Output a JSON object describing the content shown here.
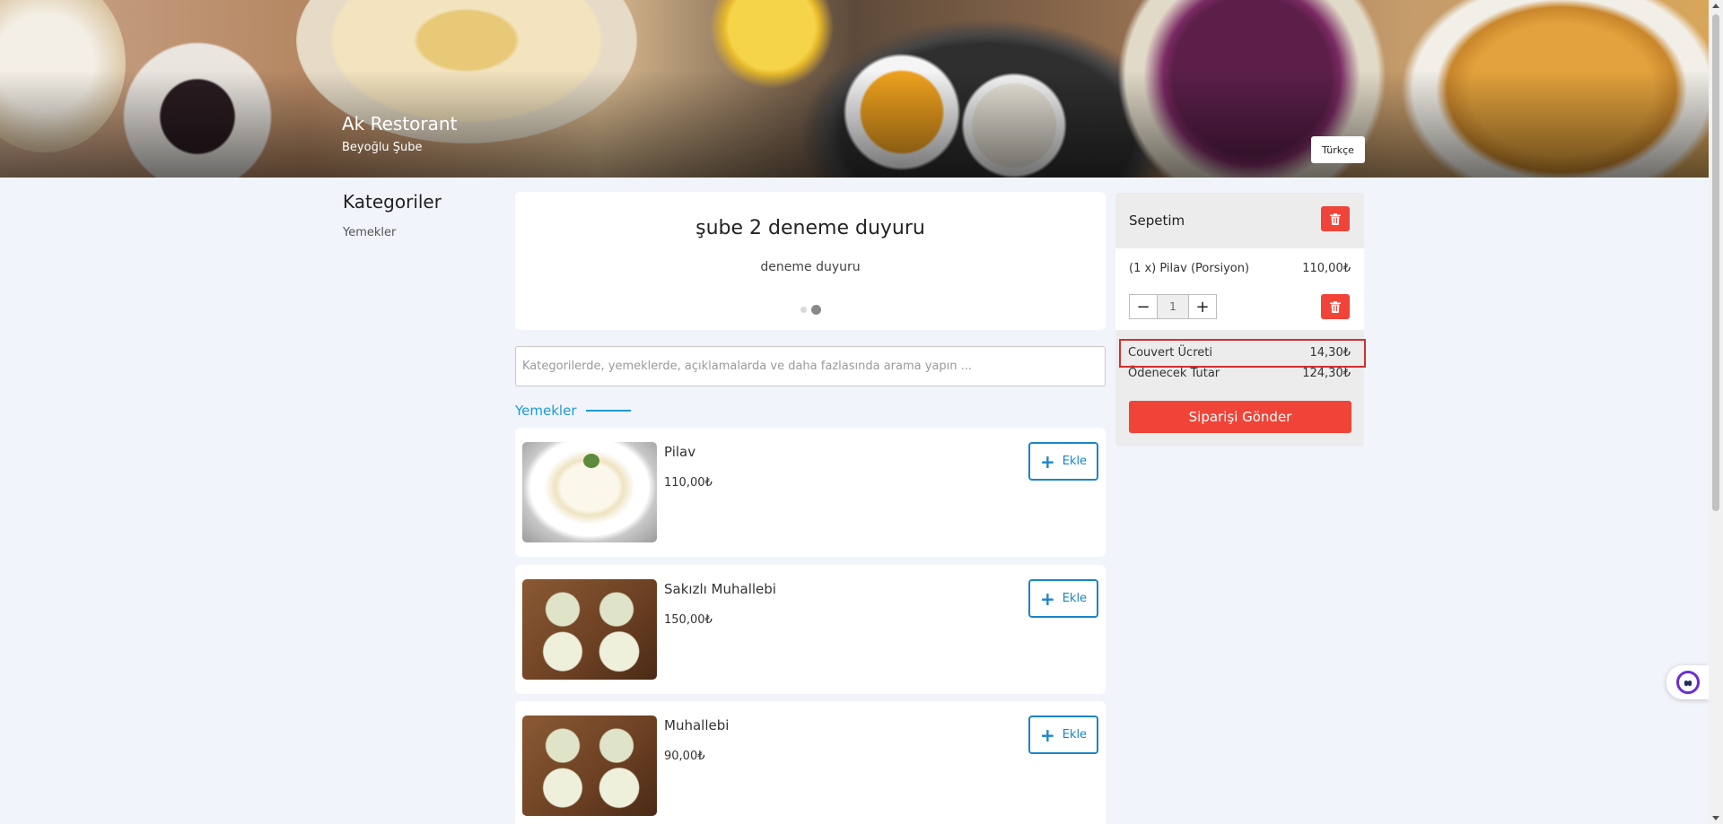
{
  "restaurant": {
    "name": "Ak Restorant",
    "branch": "Beyoğlu Şube"
  },
  "language_button": "Türkçe",
  "categories": {
    "title": "Kategoriler",
    "items": [
      "Yemekler"
    ]
  },
  "announcement": {
    "title": "şube 2 deneme duyuru",
    "body": "deneme duyuru",
    "slide_count": 2,
    "active_slide": 2
  },
  "search": {
    "placeholder": "Kategorilerde, yemeklerde, açıklamalarda ve daha fazlasında arama yapın ..."
  },
  "section": {
    "title": "Yemekler"
  },
  "products": [
    {
      "name": "Pilav",
      "price": "110,00₺",
      "button": "Ekle",
      "image": "rice-pilaf"
    },
    {
      "name": "Sakızlı Muhallebi",
      "price": "150,00₺",
      "button": "Ekle",
      "image": "pudding-cups"
    },
    {
      "name": "Muhallebi",
      "price": "90,00₺",
      "button": "Ekle",
      "image": "pudding-cups"
    }
  ],
  "cart": {
    "title": "Sepetim",
    "line": {
      "label": "(1 x) Pilav (Porsiyon)",
      "price": "110,00₺",
      "quantity": "1",
      "minus": "−",
      "plus": "+"
    },
    "cover_fee_label": "Couvert Ücreti",
    "cover_fee_value": "14,30₺",
    "total_label": "Ödenecek Tutar",
    "total_value": "124,30₺",
    "submit": "Siparişi Gönder"
  },
  "colors": {
    "accent_blue": "#1a9bd7",
    "danger_red": "#f04438",
    "page_bg": "#f1f4fa"
  }
}
